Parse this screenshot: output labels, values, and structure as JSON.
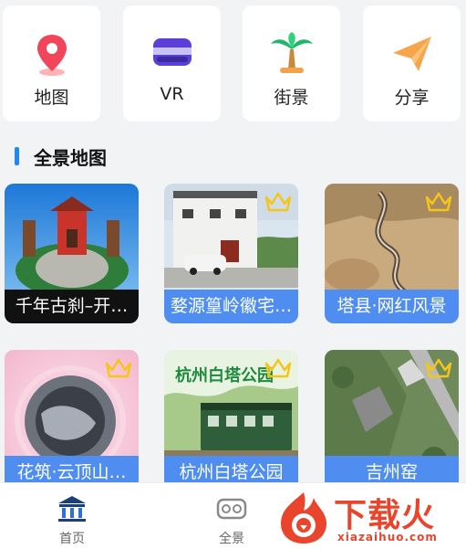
{
  "quick_actions": [
    {
      "label": "地图",
      "icon": "map-pin-icon"
    },
    {
      "label": "VR",
      "icon": "vr-headset-icon"
    },
    {
      "label": "街景",
      "icon": "palm-tree-icon"
    },
    {
      "label": "分享",
      "icon": "paper-plane-icon"
    }
  ],
  "section": {
    "title": "全景地图"
  },
  "panoramas": [
    {
      "title": "千年古刹–开…",
      "premium": false
    },
    {
      "title": "婺源篁岭徽宅…",
      "premium": true
    },
    {
      "title": "塔县·网红风景",
      "premium": true
    },
    {
      "title": "花筑·云顶山…",
      "premium": true
    },
    {
      "title": "杭州白塔公园",
      "premium": true
    },
    {
      "title": "吉州窑",
      "premium": true
    }
  ],
  "artwork_text": {
    "sign": "杭州白塔公园"
  },
  "tabbar": {
    "items": [
      {
        "label": "首页",
        "icon": "home-museum-icon",
        "active": true
      },
      {
        "label": "全景",
        "icon": "vr-goggles-icon",
        "active": false
      }
    ]
  },
  "watermark": {
    "text": "下载火",
    "url": "xiazaihuo.com"
  },
  "colors": {
    "accent": "#1f86f2",
    "caption": "#4f8ef0",
    "brand_watermark": "#e8452c"
  }
}
